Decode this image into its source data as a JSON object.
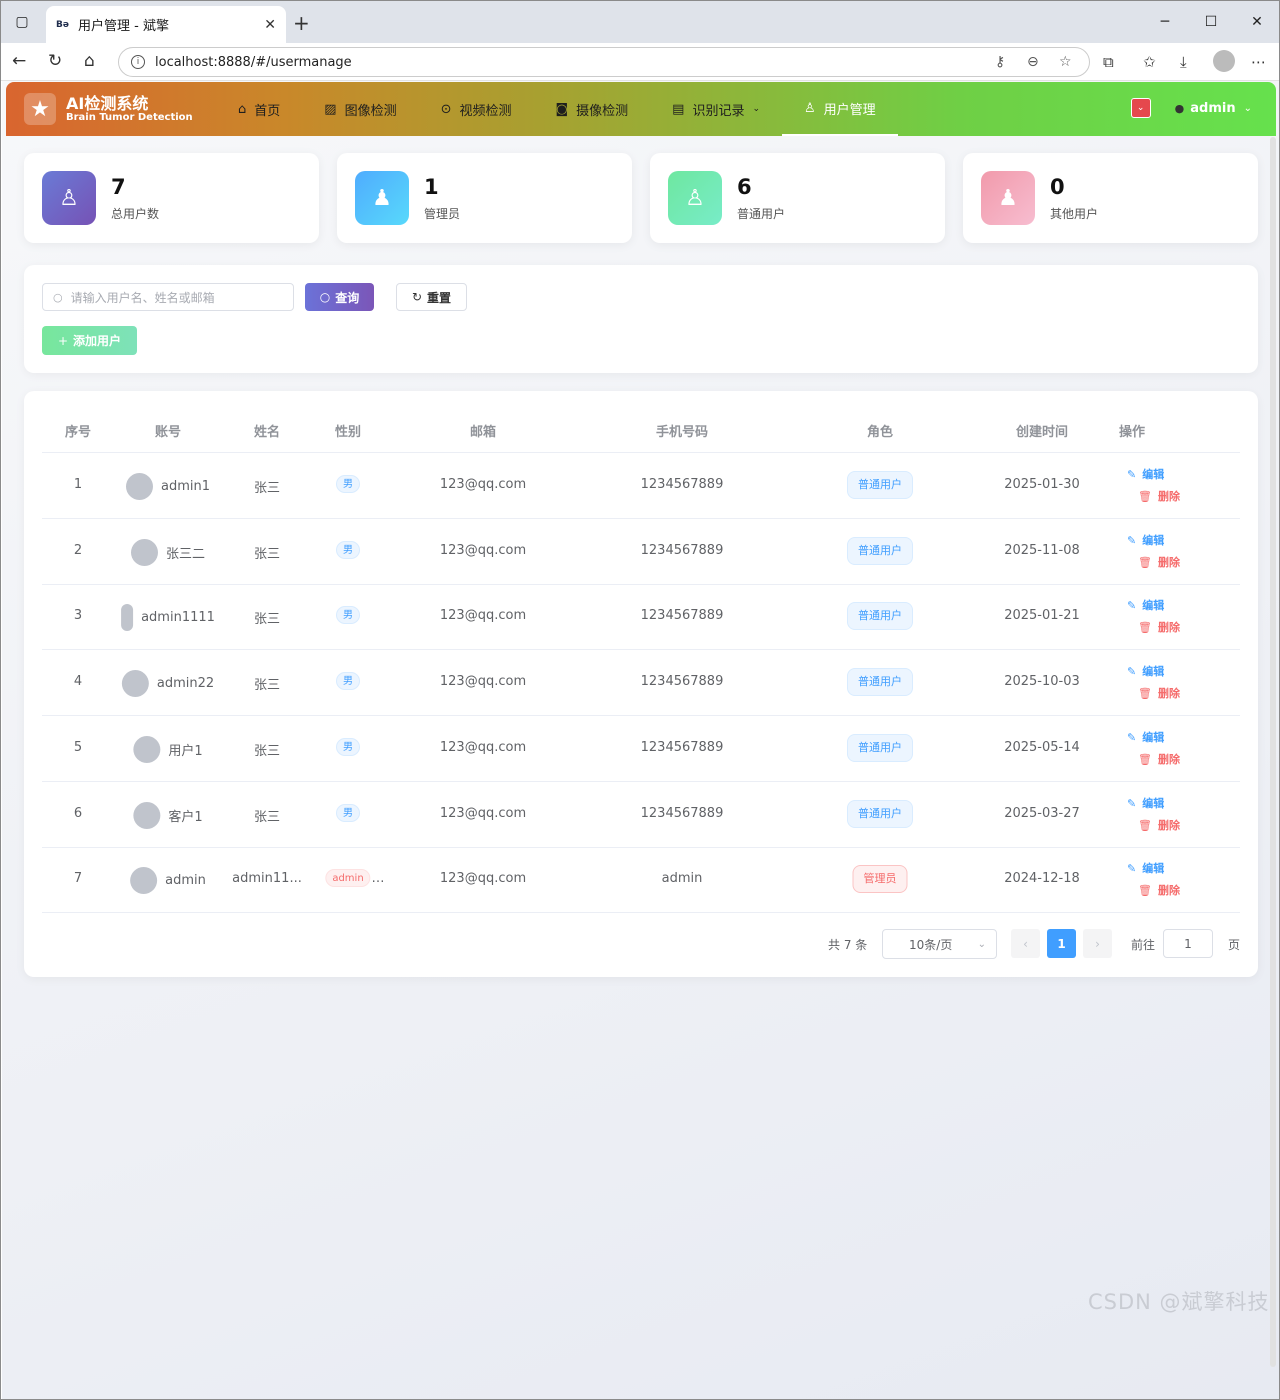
{
  "browser": {
    "tab_title": "用户管理 - 斌擎",
    "tab_favicon": "Bə",
    "url": "localhost:8888/#/usermanage"
  },
  "navbar": {
    "brand_title": "AI检测系统",
    "brand_subtitle": "Brain Tumor Detection",
    "menu": [
      {
        "label": "首页",
        "icon": "home-icon"
      },
      {
        "label": "图像检测",
        "icon": "image-icon"
      },
      {
        "label": "视频检测",
        "icon": "play-icon"
      },
      {
        "label": "摄像检测",
        "icon": "camera-icon"
      },
      {
        "label": "识别记录",
        "icon": "document-icon"
      },
      {
        "label": "用户管理",
        "icon": "user-icon"
      }
    ],
    "active_menu": "用户管理",
    "username": "admin"
  },
  "stats": [
    {
      "value": "7",
      "label": "总用户数",
      "color": "#6b6fd6"
    },
    {
      "value": "1",
      "label": "管理员",
      "color": "#4facfe"
    },
    {
      "value": "6",
      "label": "普通用户",
      "color": "#6ee7a8"
    },
    {
      "value": "0",
      "label": "其他用户",
      "color": "#f4a0b0"
    }
  ],
  "search": {
    "placeholder": "请输入用户名、姓名或邮箱",
    "query_label": "查询",
    "reset_label": "重置",
    "add_label": "添加用户"
  },
  "table": {
    "columns": [
      "序号",
      "账号",
      "姓名",
      "性别",
      "邮箱",
      "手机号码",
      "角色",
      "创建时间",
      "操作"
    ],
    "edit_label": "编辑",
    "delete_label": "删除",
    "rows": [
      {
        "index": "1",
        "account": "admin1",
        "name": "张三",
        "gender": "男",
        "email": "123@qq.com",
        "phone": "1234567889",
        "role": "普通用户",
        "created": "2025-01-30"
      },
      {
        "index": "2",
        "account": "张三二",
        "name": "张三",
        "gender": "男",
        "email": "123@qq.com",
        "phone": "1234567889",
        "role": "普通用户",
        "created": "2025-11-08"
      },
      {
        "index": "3",
        "account": "admin1111",
        "name": "张三",
        "gender": "男",
        "email": "123@qq.com",
        "phone": "1234567889",
        "role": "普通用户",
        "created": "2025-01-21"
      },
      {
        "index": "4",
        "account": "admin22",
        "name": "张三",
        "gender": "男",
        "email": "123@qq.com",
        "phone": "1234567889",
        "role": "普通用户",
        "created": "2025-10-03"
      },
      {
        "index": "5",
        "account": "用户1",
        "name": "张三",
        "gender": "男",
        "email": "123@qq.com",
        "phone": "1234567889",
        "role": "普通用户",
        "created": "2025-05-14"
      },
      {
        "index": "6",
        "account": "客户1",
        "name": "张三",
        "gender": "男",
        "email": "123@qq.com",
        "phone": "1234567889",
        "role": "普通用户",
        "created": "2025-03-27"
      },
      {
        "index": "7",
        "account": "admin",
        "name": "admin11...",
        "gender": "admin",
        "email": "123@qq.com",
        "phone": "admin",
        "role": "管理员",
        "created": "2024-12-18"
      }
    ]
  },
  "pagination": {
    "total": "共 7 条",
    "page_size": "10条/页",
    "current": "1",
    "goto_prefix": "前往",
    "goto_value": "1",
    "goto_suffix": "页"
  },
  "watermark": "CSDN @斌擎科技"
}
